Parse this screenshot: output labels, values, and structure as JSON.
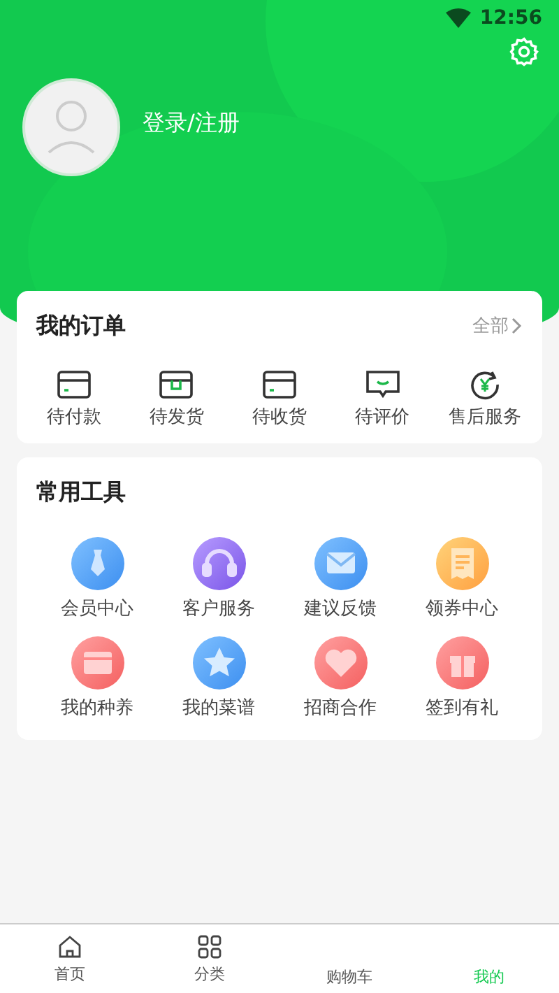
{
  "status_bar": {
    "time": "12:56"
  },
  "profile": {
    "login_label": "登录/注册"
  },
  "orders": {
    "title": "我的订单",
    "all_link": "全部",
    "items": [
      {
        "label": "待付款"
      },
      {
        "label": "待发货"
      },
      {
        "label": "待收货"
      },
      {
        "label": "待评价"
      },
      {
        "label": "售后服务"
      }
    ]
  },
  "tools": {
    "title": "常用工具",
    "items": [
      {
        "label": "会员中心"
      },
      {
        "label": "客户服务"
      },
      {
        "label": "建议反馈"
      },
      {
        "label": "领券中心"
      },
      {
        "label": "我的种养"
      },
      {
        "label": "我的菜谱"
      },
      {
        "label": "招商合作"
      },
      {
        "label": "签到有礼"
      }
    ]
  },
  "tab_bar": [
    {
      "label": "首页",
      "selected": false
    },
    {
      "label": "分类",
      "selected": false
    },
    {
      "label": "购物车",
      "selected": false
    },
    {
      "label": "我的",
      "selected": true
    }
  ]
}
